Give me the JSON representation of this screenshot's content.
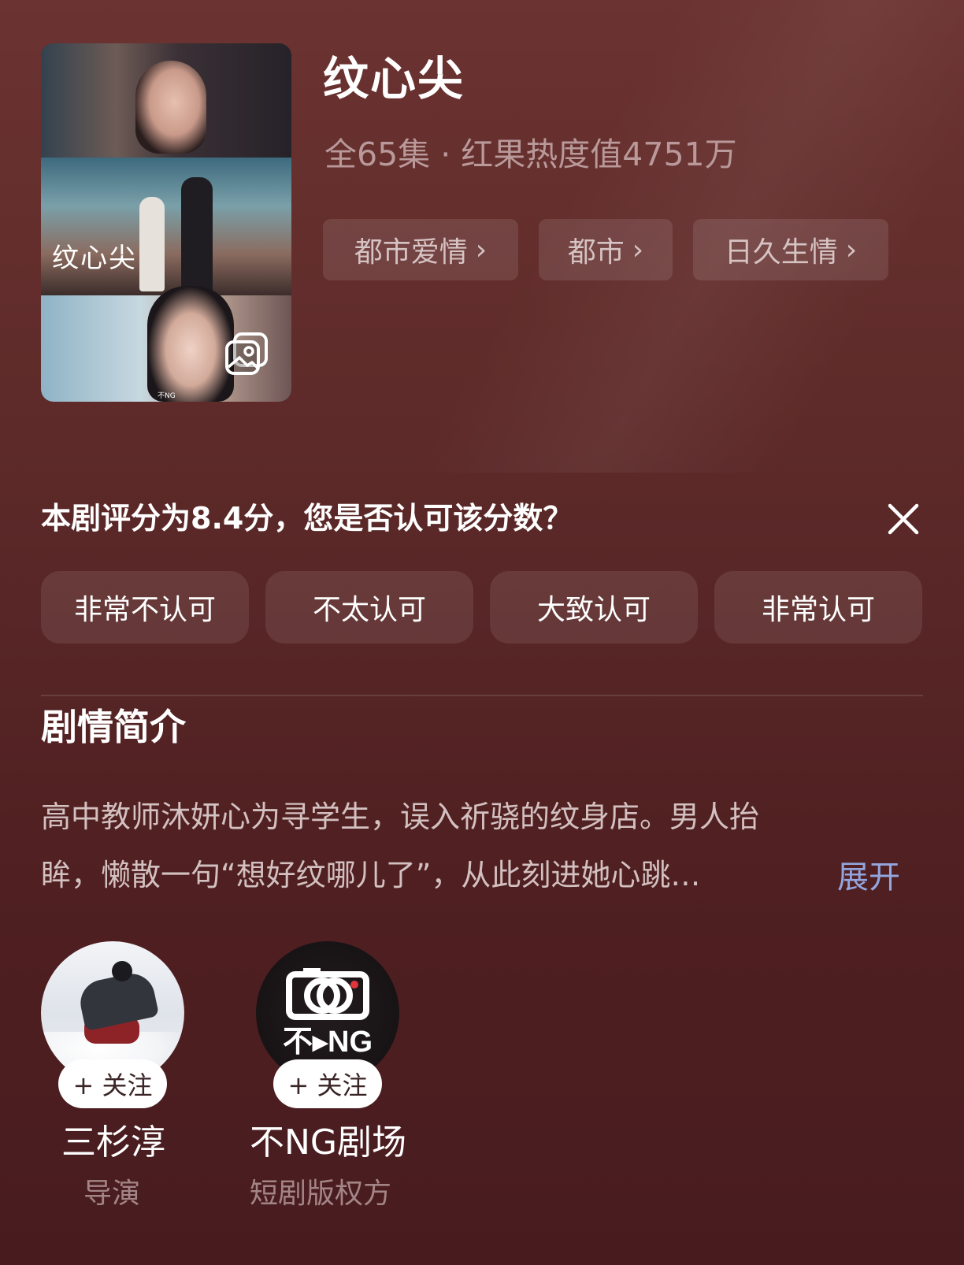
{
  "drama": {
    "title": "纹心尖",
    "meta": "全65集 · 红果热度值4751万",
    "tags": [
      "都市爱情",
      "都市",
      "日久生情"
    ],
    "poster": {
      "title_art": "纹心尖",
      "brand": "不NG"
    }
  },
  "rating": {
    "question": "本剧评分为8.4分，您是否认可该分数？",
    "score": 8.4,
    "options": [
      "非常不认可",
      "不太认可",
      "大致认可",
      "非常认可"
    ]
  },
  "synopsis": {
    "heading": "剧情简介",
    "lines": [
      "高中教师沐妍心为寻学生，误入祈骁的纹身店。男人抬",
      "眸，懒散一句“想好纹哪儿了”，从此刻进她心跳…"
    ],
    "expand_label": "展开"
  },
  "people": [
    {
      "name": "三杉淳",
      "role": "导演",
      "follow_label": "+ 关注"
    },
    {
      "name": "不NG剧场",
      "role": "短剧版权方",
      "follow_label": "+ 关注",
      "logo_text": "不▸NG"
    }
  ],
  "icons": {
    "close": "close-icon",
    "gallery": "gallery-icon",
    "chevron": "chevron-right-icon"
  },
  "colors": {
    "background": "#5d2a29",
    "link": "#93a6df",
    "muted_text": "#b9999a"
  }
}
